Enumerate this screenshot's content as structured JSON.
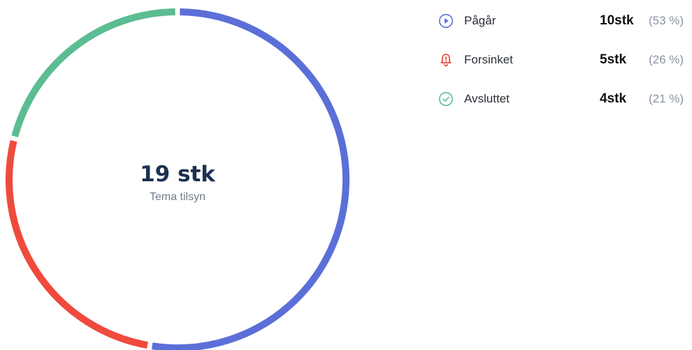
{
  "center": {
    "value": "19 stk",
    "caption": "Tema tilsyn"
  },
  "legend": [
    {
      "label": "Pågår",
      "count": "10stk",
      "percent": "(53 %)",
      "icon": "play-circle-icon",
      "color": "#5b6fd8"
    },
    {
      "label": "Forsinket",
      "count": "5stk",
      "percent": "(26 %)",
      "icon": "bell-alert-icon",
      "color": "#f04a3c"
    },
    {
      "label": "Avsluttet",
      "count": "4stk",
      "percent": "(21 %)",
      "icon": "check-circle-icon",
      "color": "#5cbc92"
    }
  ],
  "chart_data": {
    "type": "pie",
    "style": "donut",
    "categories": [
      "Pågår",
      "Forsinket",
      "Avsluttet"
    ],
    "values": [
      10,
      5,
      4
    ],
    "percentages": [
      53,
      26,
      21
    ],
    "colors": [
      "#5b6fd8",
      "#f04a3c",
      "#5cbc92"
    ],
    "total": 19,
    "unit": "stk",
    "start": "top",
    "direction": "clockwise",
    "legend_position": "right"
  }
}
